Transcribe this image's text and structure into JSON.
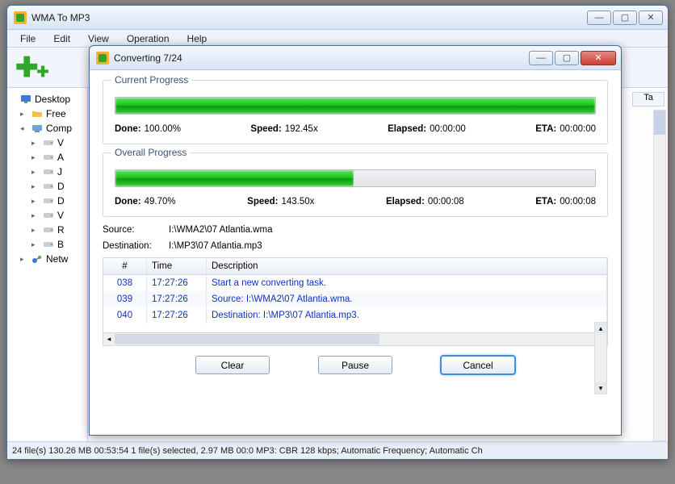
{
  "main": {
    "title": "WMA To MP3",
    "menu": [
      "File",
      "Edit",
      "View",
      "Operation",
      "Help"
    ],
    "tree": [
      {
        "label": "Desktop",
        "icon": "monitor",
        "indent": 0,
        "toggle": ""
      },
      {
        "label": "Free",
        "icon": "folder",
        "indent": 1,
        "toggle": "▸"
      },
      {
        "label": "Comp",
        "icon": "computer",
        "indent": 1,
        "toggle": "◂"
      },
      {
        "label": "V",
        "icon": "drive",
        "indent": 2,
        "toggle": "▸"
      },
      {
        "label": "A",
        "icon": "drive",
        "indent": 2,
        "toggle": "▸"
      },
      {
        "label": "J",
        "icon": "drive",
        "indent": 2,
        "toggle": "▸"
      },
      {
        "label": "D",
        "icon": "drive",
        "indent": 2,
        "toggle": "▸"
      },
      {
        "label": "D",
        "icon": "drive",
        "indent": 2,
        "toggle": "▸"
      },
      {
        "label": "V",
        "icon": "drive",
        "indent": 2,
        "toggle": "▸"
      },
      {
        "label": "R",
        "icon": "drive",
        "indent": 2,
        "toggle": "▸"
      },
      {
        "label": "B",
        "icon": "drive",
        "indent": 2,
        "toggle": "▸"
      },
      {
        "label": "Netw",
        "icon": "network",
        "indent": 1,
        "toggle": "▸"
      }
    ],
    "right_header": "Ta",
    "status": "24 file(s)   130.26 MB   00:53:54   1 file(s) selected, 2.97 MB   00:0   MP3:  CBR 128 kbps; Automatic Frequency; Automatic Ch"
  },
  "dialog": {
    "title": "Converting 7/24",
    "current": {
      "title": "Current Progress",
      "percent": 100,
      "done_label": "Done:",
      "done": "100.00%",
      "speed_label": "Speed:",
      "speed": "192.45x",
      "elapsed_label": "Elapsed:",
      "elapsed": "00:00:00",
      "eta_label": "ETA:",
      "eta": "00:00:00"
    },
    "overall": {
      "title": "Overall Progress",
      "percent": 49.7,
      "done_label": "Done:",
      "done": "49.70%",
      "speed_label": "Speed:",
      "speed": "143.50x",
      "elapsed_label": "Elapsed:",
      "elapsed": "00:00:08",
      "eta_label": "ETA:",
      "eta": "00:00:08"
    },
    "source_label": "Source:",
    "source": "I:\\WMA2\\07 Atlantia.wma",
    "dest_label": "Destination:",
    "dest": "I:\\MP3\\07 Atlantia.mp3",
    "log_headers": {
      "n": "#",
      "t": "Time",
      "d": "Description"
    },
    "log": [
      {
        "n": "038",
        "t": "17:27:26",
        "d": "Start a new converting task."
      },
      {
        "n": "039",
        "t": "17:27:26",
        "d": "Source:  I:\\WMA2\\07 Atlantia.wma."
      },
      {
        "n": "040",
        "t": "17:27:26",
        "d": "Destination: I:\\MP3\\07 Atlantia.mp3."
      }
    ],
    "buttons": {
      "clear": "Clear",
      "pause": "Pause",
      "cancel": "Cancel"
    }
  }
}
